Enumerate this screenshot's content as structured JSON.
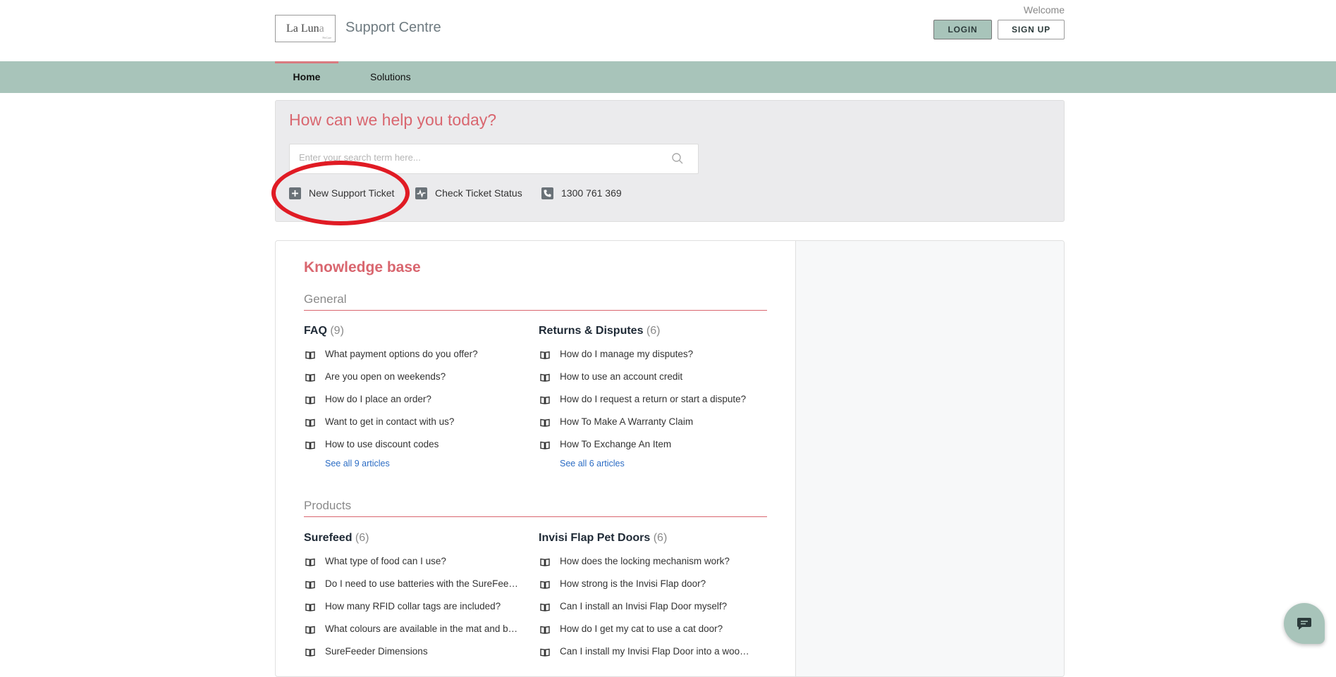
{
  "header": {
    "logo_main": "La Lun",
    "logo_dim": "a",
    "logo_sub": "PetCare",
    "site_title": "Support Centre",
    "welcome": "Welcome",
    "login_label": "LOGIN",
    "signup_label": "SIGN UP"
  },
  "nav": {
    "home": "Home",
    "solutions": "Solutions"
  },
  "hero": {
    "title": "How can we help you today?",
    "search_placeholder": "Enter your search term here...",
    "actions": {
      "new_ticket": "New Support Ticket",
      "check_status": "Check Ticket Status",
      "phone": "1300 761 369"
    }
  },
  "kb": {
    "title": "Knowledge base",
    "sections": {
      "general": "General",
      "products": "Products"
    },
    "faq": {
      "name": "FAQ",
      "count": "(9)",
      "articles": [
        "What payment options do you offer?",
        "Are you open on weekends?",
        "How do I place an order?",
        "Want to get in contact with us?",
        "How to use discount codes"
      ],
      "see_all": "See all 9 articles"
    },
    "returns": {
      "name": "Returns & Disputes",
      "count": "(6)",
      "articles": [
        "How do I manage my disputes?",
        "How to use an account credit",
        "How do I request a return or start a dispute?",
        "How To Make A Warranty Claim",
        "How To Exchange An Item"
      ],
      "see_all": "See all 6 articles"
    },
    "surefeed": {
      "name": "Surefeed",
      "count": "(6)",
      "articles": [
        "What type of food can I use?",
        "Do I need to use batteries with the SureFeeder?",
        "How many RFID collar tags are included?",
        "What colours are available in the mat and bowls?",
        "SureFeeder Dimensions"
      ]
    },
    "invisi": {
      "name": "Invisi Flap Pet Doors",
      "count": "(6)",
      "articles": [
        "How does the locking mechanism work?",
        "How strong is the Invisi Flap door?",
        "Can I install an Invisi Flap Door myself?",
        "How do I get my cat to use a cat door?",
        "Can I install my Invisi Flap Door into a wooden door?"
      ]
    }
  },
  "colors": {
    "accent": "#d9666f",
    "nav_bg": "#a8c4ba",
    "link": "#2b6cc4",
    "annotation": "#e01b24"
  }
}
